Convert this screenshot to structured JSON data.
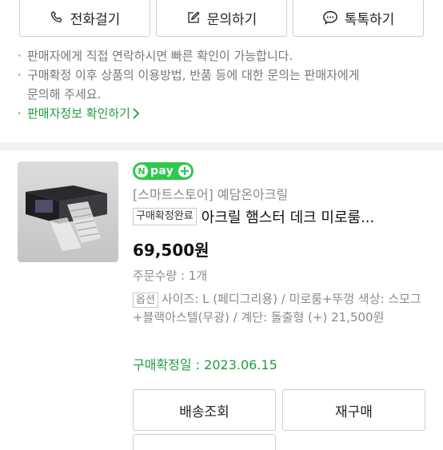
{
  "seller_actions": [
    {
      "label": "전화걸기",
      "icon": "phone-icon"
    },
    {
      "label": "문의하기",
      "icon": "edit-icon"
    },
    {
      "label": "톡톡하기",
      "icon": "chat-bubble-icon"
    }
  ],
  "notice": {
    "line1": "판매자에게 직접 연락하시면 빠른 확인이 가능합니다.",
    "line2a": "구매확정 이후 상품의 이용방법, 반품 등에 대한 문의는 판매자에게",
    "line2b": "문의해 주세요.",
    "seller_info_link": "판매자정보 확인하기"
  },
  "order": {
    "npay_badge": "pay",
    "store": "[스마트스토어] 예담온아크릴",
    "status_badge": "구매확정완료",
    "product_title": "아크릴 햄스터 데크 미로룸...",
    "price": "69,500원",
    "quantity": "주문수량 : 1개",
    "option_tag": "옵션",
    "option_text": "사이즈: L (페디그리용) / 미로룸+뚜껑 색상: 스모그+블랙아스텔(무광) / 계단: 돌출형 (+) 21,500원",
    "confirm_date": "구매확정일 : 2023.06.15"
  },
  "actions": {
    "tracking": "배송조회",
    "reorder": "재구매"
  },
  "colors": {
    "accent_green": "#1e9e3e",
    "npay_green": "#2ec84f"
  }
}
